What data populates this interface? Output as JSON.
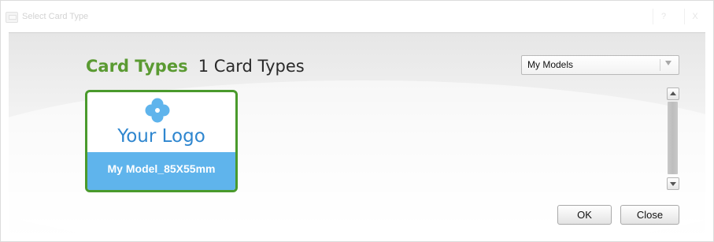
{
  "window": {
    "title": "Select Card Type",
    "help_label": "?",
    "close_label": "X"
  },
  "header": {
    "label": "Card Types",
    "count": "1 Card Types"
  },
  "filter": {
    "selected": "My Models"
  },
  "cards": [
    {
      "logo_text": "Your Logo",
      "name": "My Model_85X55mm",
      "selected": true
    }
  ],
  "buttons": {
    "ok": "OK",
    "close": "Close"
  },
  "colors": {
    "heading_green": "#5a9a32",
    "card_border": "#4a9a2c",
    "logo_blue": "#2e86cf",
    "card_label_bg": "#5fb4ec"
  }
}
